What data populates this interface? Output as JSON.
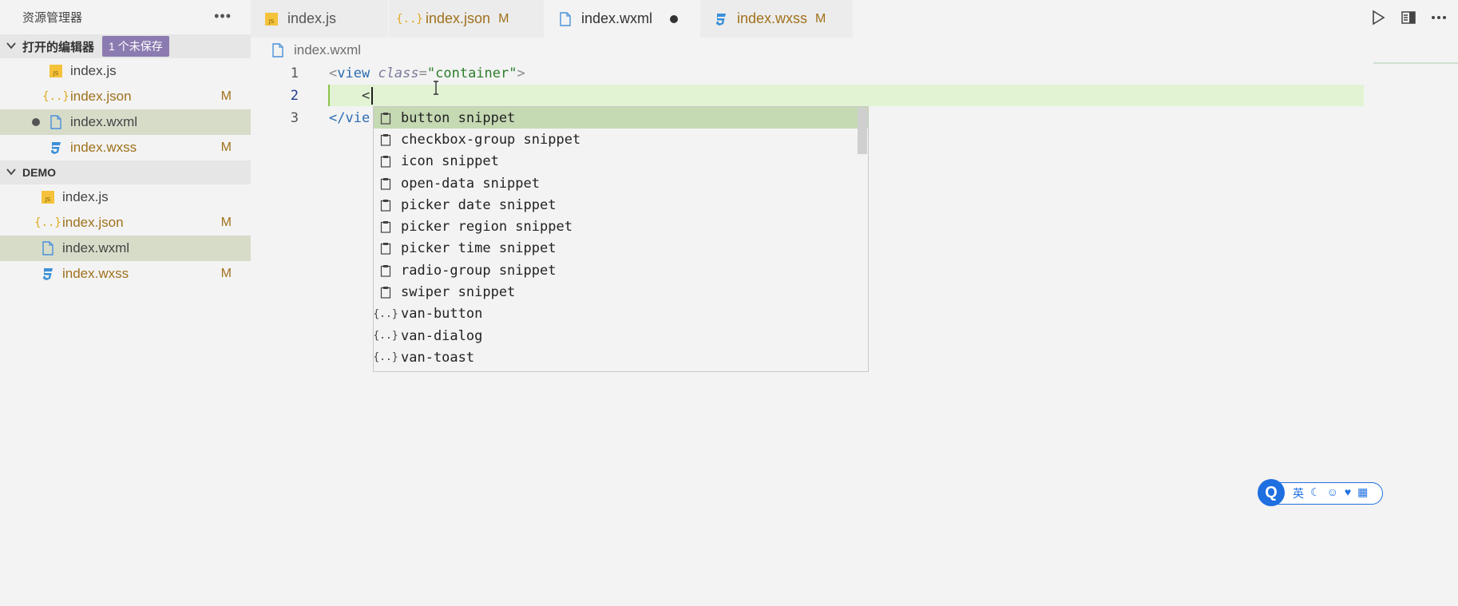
{
  "sidebar": {
    "title": "资源管理器",
    "more": "•••",
    "open_editors": {
      "label": "打开的编辑器",
      "badge": "1 个未保存",
      "files": [
        {
          "name": "index.js",
          "icon": "js-file-icon",
          "flag": ""
        },
        {
          "name": "index.json",
          "icon": "json-file-icon",
          "flag": "M"
        },
        {
          "name": "index.wxml",
          "icon": "wxml-file-icon",
          "flag": ""
        },
        {
          "name": "index.wxss",
          "icon": "wxss-file-icon",
          "flag": "M"
        }
      ]
    },
    "project": {
      "label": "DEMO",
      "files": [
        {
          "name": "index.js",
          "icon": "js-file-icon",
          "flag": ""
        },
        {
          "name": "index.json",
          "icon": "json-file-icon",
          "flag": "M"
        },
        {
          "name": "index.wxml",
          "icon": "wxml-file-icon",
          "flag": ""
        },
        {
          "name": "index.wxss",
          "icon": "wxss-file-icon",
          "flag": "M"
        }
      ]
    }
  },
  "tabs": [
    {
      "name": "index.js",
      "flag": ""
    },
    {
      "name": "index.json",
      "flag": "M"
    },
    {
      "name": "index.wxml",
      "flag": ""
    },
    {
      "name": "index.wxss",
      "flag": "M"
    }
  ],
  "breadcrumb": {
    "file": "index.wxml"
  },
  "editor": {
    "lines": [
      {
        "num": "1",
        "indent": "",
        "lt": "<",
        "tag": "view",
        "attr": "class",
        "eq": "=",
        "val": "\"container\"",
        "gt": ">"
      },
      {
        "num": "2",
        "indent": "    ",
        "text": "<"
      },
      {
        "num": "3",
        "text": "</vie"
      }
    ]
  },
  "suggest": {
    "items": [
      {
        "label": "button snippet",
        "icon": "snippet-icon"
      },
      {
        "label": "checkbox-group snippet",
        "icon": "snippet-icon"
      },
      {
        "label": "icon snippet",
        "icon": "snippet-icon"
      },
      {
        "label": "open-data snippet",
        "icon": "snippet-icon"
      },
      {
        "label": "picker date snippet",
        "icon": "snippet-icon"
      },
      {
        "label": "picker region snippet",
        "icon": "snippet-icon"
      },
      {
        "label": "picker time snippet",
        "icon": "snippet-icon"
      },
      {
        "label": "radio-group snippet",
        "icon": "snippet-icon"
      },
      {
        "label": "swiper snippet",
        "icon": "snippet-icon"
      },
      {
        "label": "van-button",
        "icon": "component-icon"
      },
      {
        "label": "van-dialog",
        "icon": "component-icon"
      },
      {
        "label": "van-toast",
        "icon": "component-icon"
      }
    ]
  },
  "ime": {
    "lang": "英"
  },
  "colors": {
    "modified": "#a0711c",
    "badge": "#8c7bb0",
    "current_line": "#e1f3d3",
    "suggest_focus": "#c5d9b3"
  }
}
